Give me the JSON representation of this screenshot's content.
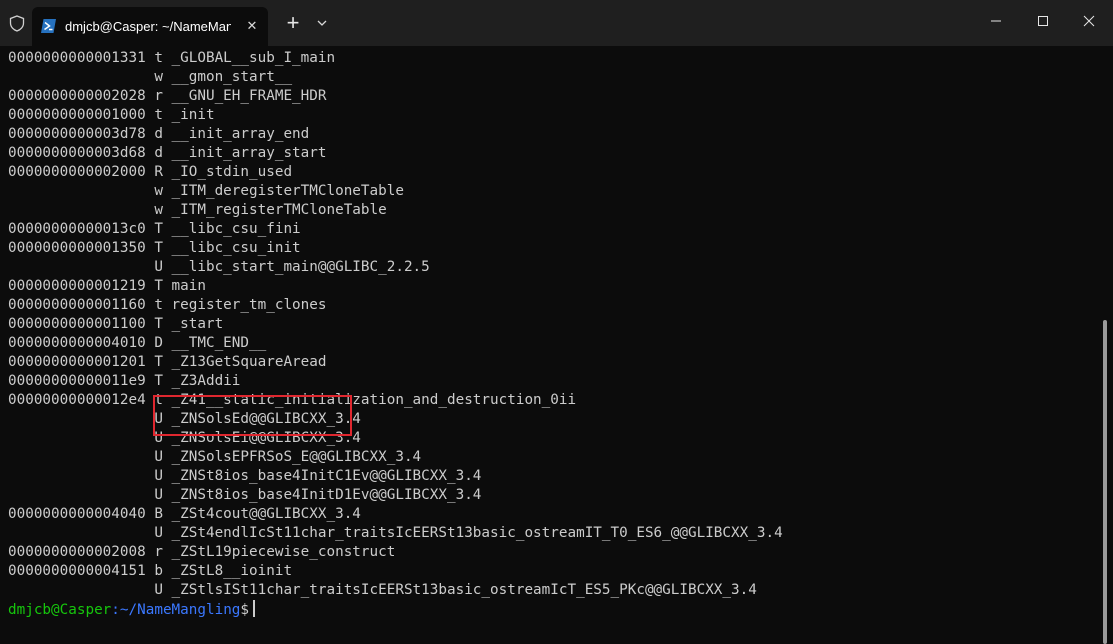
{
  "window": {
    "tab_title": "dmjcb@Casper: ~/NameMangling",
    "close_symbol": "✕",
    "new_tab_symbol": "+"
  },
  "terminal": {
    "lines": [
      "0000000000001331 t _GLOBAL__sub_I_main",
      "                 w __gmon_start__",
      "0000000000002028 r __GNU_EH_FRAME_HDR",
      "0000000000001000 t _init",
      "0000000000003d78 d __init_array_end",
      "0000000000003d68 d __init_array_start",
      "0000000000002000 R _IO_stdin_used",
      "                 w _ITM_deregisterTMCloneTable",
      "                 w _ITM_registerTMCloneTable",
      "00000000000013c0 T __libc_csu_fini",
      "0000000000001350 T __libc_csu_init",
      "                 U __libc_start_main@@GLIBC_2.2.5",
      "0000000000001219 T main",
      "0000000000001160 t register_tm_clones",
      "0000000000001100 T _start",
      "0000000000004010 D __TMC_END__",
      "0000000000001201 T _Z13GetSquareAread",
      "00000000000011e9 T _Z3Addii",
      "00000000000012e4 t _Z41__static_initialization_and_destruction_0ii",
      "                 U _ZNSolsEd@@GLIBCXX_3.4",
      "                 U _ZNSolsEi@@GLIBCXX_3.4",
      "                 U _ZNSolsEPFRSoS_E@@GLIBCXX_3.4",
      "                 U _ZNSt8ios_base4InitC1Ev@@GLIBCXX_3.4",
      "                 U _ZNSt8ios_base4InitD1Ev@@GLIBCXX_3.4",
      "0000000000004040 B _ZSt4cout@@GLIBCXX_3.4",
      "                 U _ZSt4endlIcSt11char_traitsIcEERSt13basic_ostreamIT_T0_ES6_@@GLIBCXX_3.4",
      "0000000000002008 r _ZStL19piecewise_construct",
      "0000000000004151 b _ZStL8__ioinit",
      "                 U _ZStlsISt11char_traitsIcEERSt13basic_ostreamIcT_ES5_PKc@@GLIBCXX_3.4"
    ],
    "prompt": {
      "user": "dmjcb@Casper",
      "path": ":~/NameMangling",
      "sign": "$"
    }
  },
  "colors": {
    "background": "#0c0c0c",
    "text": "#cccccc",
    "prompt_user": "#16c60c",
    "prompt_path": "#3b78ff",
    "highlight_border": "#e0272f"
  }
}
